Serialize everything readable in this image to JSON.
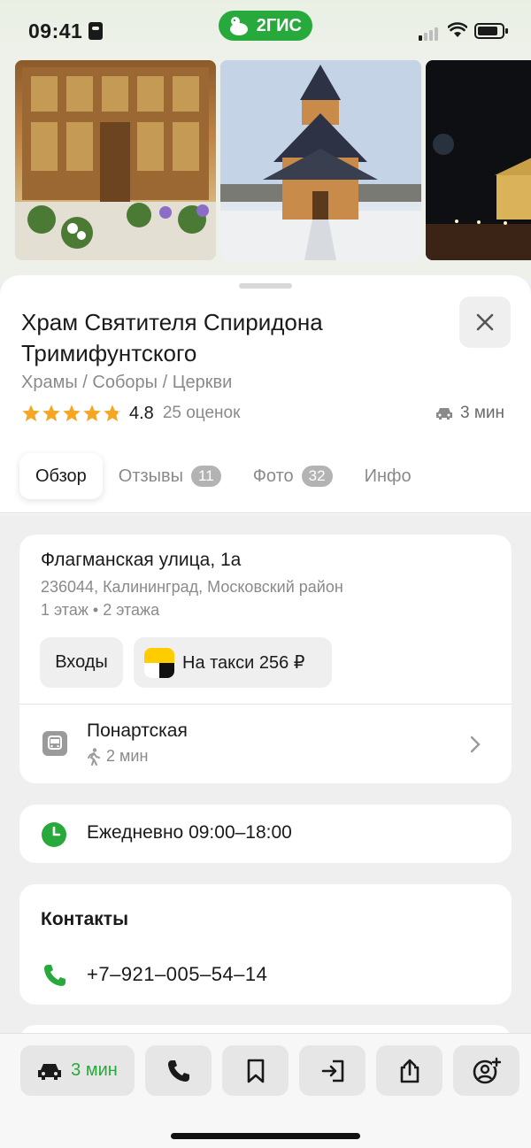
{
  "status_bar": {
    "time": "09:41",
    "brand": "2ГИС"
  },
  "place": {
    "title": "Храм Святителя Спиридона Тримифунтского",
    "category": "Храмы / Соборы / Церкви",
    "rating": 4.8,
    "rating_text": "4.8",
    "rating_count": "25 оценок",
    "eta": "3 мин"
  },
  "tabs": [
    {
      "label": "Обзор",
      "count": ""
    },
    {
      "label": "Отзывы",
      "count": "11"
    },
    {
      "label": "Фото",
      "count": "32"
    },
    {
      "label": "Инфо",
      "count": ""
    }
  ],
  "address": {
    "street": "Флагманская улица, 1а",
    "details": "236044, Калининград, Московский район",
    "floors": "1 этаж • 2 этажа",
    "entries_label": "Входы",
    "taxi_label": "На такси 256 ₽"
  },
  "transit": {
    "stop": "Понартская",
    "walk": "2 мин"
  },
  "hours": {
    "text": "Ежедневно 09:00–18:00"
  },
  "contacts": {
    "title": "Контакты",
    "phone": "+7‒921‒005‒54‒14"
  },
  "bottom_bar": {
    "route_label": "3 мин"
  },
  "colors": {
    "accent": "#27a93b",
    "star": "#f5a623"
  }
}
